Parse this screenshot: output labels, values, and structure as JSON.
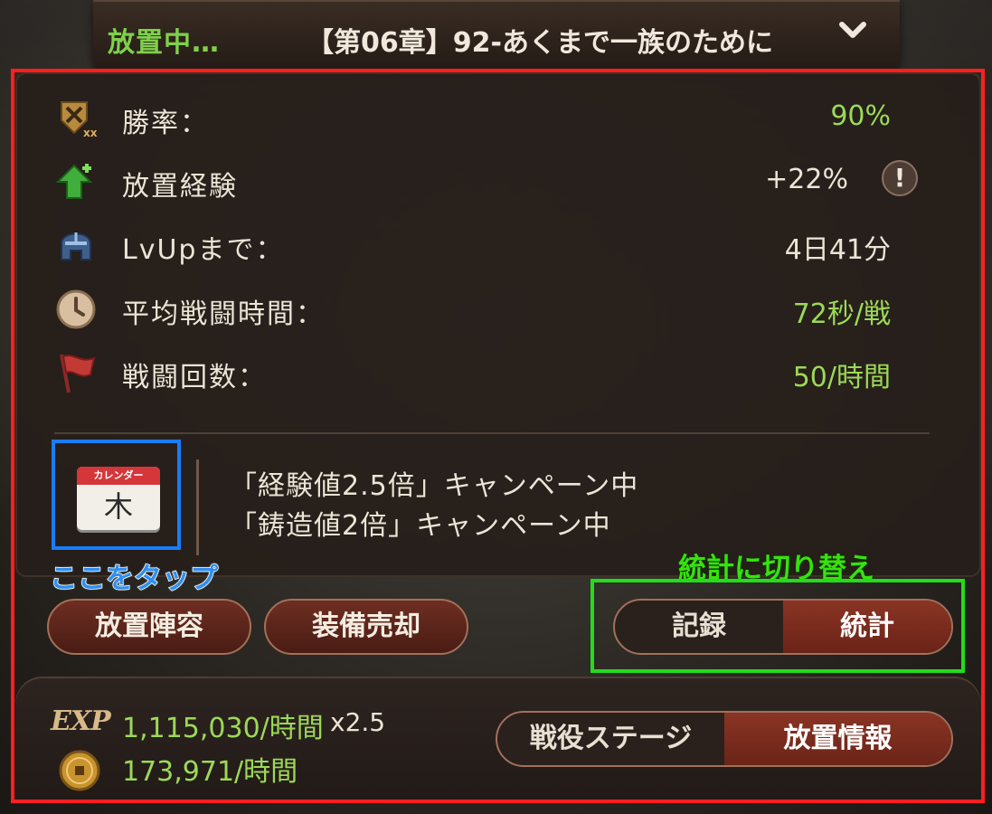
{
  "header": {
    "status": "放置中…",
    "stage_title": "【第06章】92-あくまで一族のために"
  },
  "stats": [
    {
      "label": "勝率：",
      "value": "90%",
      "icon": "win-rate-shield-icon",
      "color": "#9bd957"
    },
    {
      "label": "放置経験",
      "value": "+22%",
      "icon": "green-arrow-up-icon",
      "color": "#ece4d6"
    },
    {
      "label": "LvUpまで：",
      "value": "4日41分",
      "icon": "helmet-icon",
      "color": "#ece4d6"
    },
    {
      "label": "平均戦闘時間：",
      "value": "72秒/戦",
      "icon": "clock-icon",
      "color": "#9bd957"
    },
    {
      "label": "戦闘回数：",
      "value": "50/時間",
      "icon": "red-flag-icon",
      "color": "#9bd957"
    }
  ],
  "info_icon_text": "!",
  "calendar": {
    "header": "カレンダー",
    "day": "木"
  },
  "campaigns": [
    "「経験値2.5倍」キャンペーン中",
    "「鋳造値2倍」キャンペーン中"
  ],
  "annotations": {
    "tap_here": "ここをタップ",
    "switch_to_stats": "統計に切り替え"
  },
  "buttons": {
    "idle_lineup": "放置陣容",
    "sell_equipment": "装備売却"
  },
  "record_toggle": {
    "options": [
      "記録",
      "統計"
    ],
    "active": "統計"
  },
  "footer": {
    "exp_label": "EXP",
    "exp_rate": "1,115,030/時間",
    "exp_multiplier": "x2.5",
    "gold_rate": "173,971/時間",
    "tabs": [
      "戦役ステージ",
      "放置情報"
    ],
    "active_tab": "放置情報"
  },
  "colors": {
    "accent_green": "#9bd957",
    "annotation_red": "#ff1f1f",
    "annotation_blue": "#1a7cff",
    "annotation_green": "#23dc1b",
    "button_red": "#6e2e22"
  }
}
